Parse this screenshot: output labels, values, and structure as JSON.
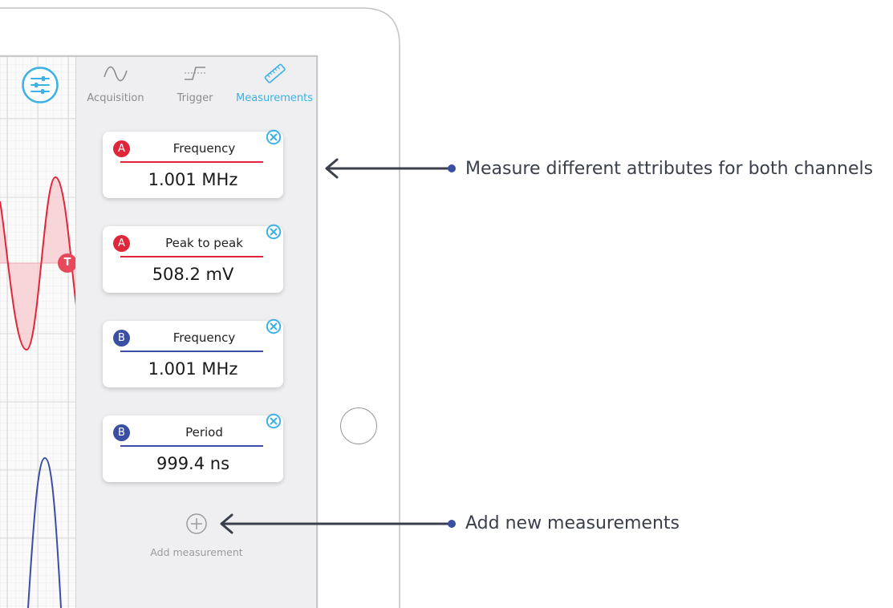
{
  "tabs": [
    {
      "label": "Acquisition",
      "icon": "sine-wave-icon",
      "active": false
    },
    {
      "label": "Trigger",
      "icon": "trigger-edge-icon",
      "active": false
    },
    {
      "label": "Measurements",
      "icon": "ruler-icon",
      "active": true
    }
  ],
  "settings_button": {
    "icon": "sliders-icon"
  },
  "trigger_marker": {
    "label": "T"
  },
  "measurements": [
    {
      "channel": "A",
      "name": "Frequency",
      "value": "1.001 MHz"
    },
    {
      "channel": "A",
      "name": "Peak to peak",
      "value": "508.2 mV"
    },
    {
      "channel": "B",
      "name": "Frequency",
      "value": "1.001 MHz"
    },
    {
      "channel": "B",
      "name": "Period",
      "value": "999.4 ns"
    }
  ],
  "add_measurement": {
    "label": "Add measurement",
    "icon": "plus-circle-icon"
  },
  "callouts": [
    {
      "text": "Measure different attributes for both channels"
    },
    {
      "text": "Add new measurements"
    }
  ],
  "colors": {
    "accent": "#3bb1e6",
    "channel_a": "#e0263a",
    "channel_b": "#3a4fa3",
    "annotation": "#3a3f4b"
  }
}
